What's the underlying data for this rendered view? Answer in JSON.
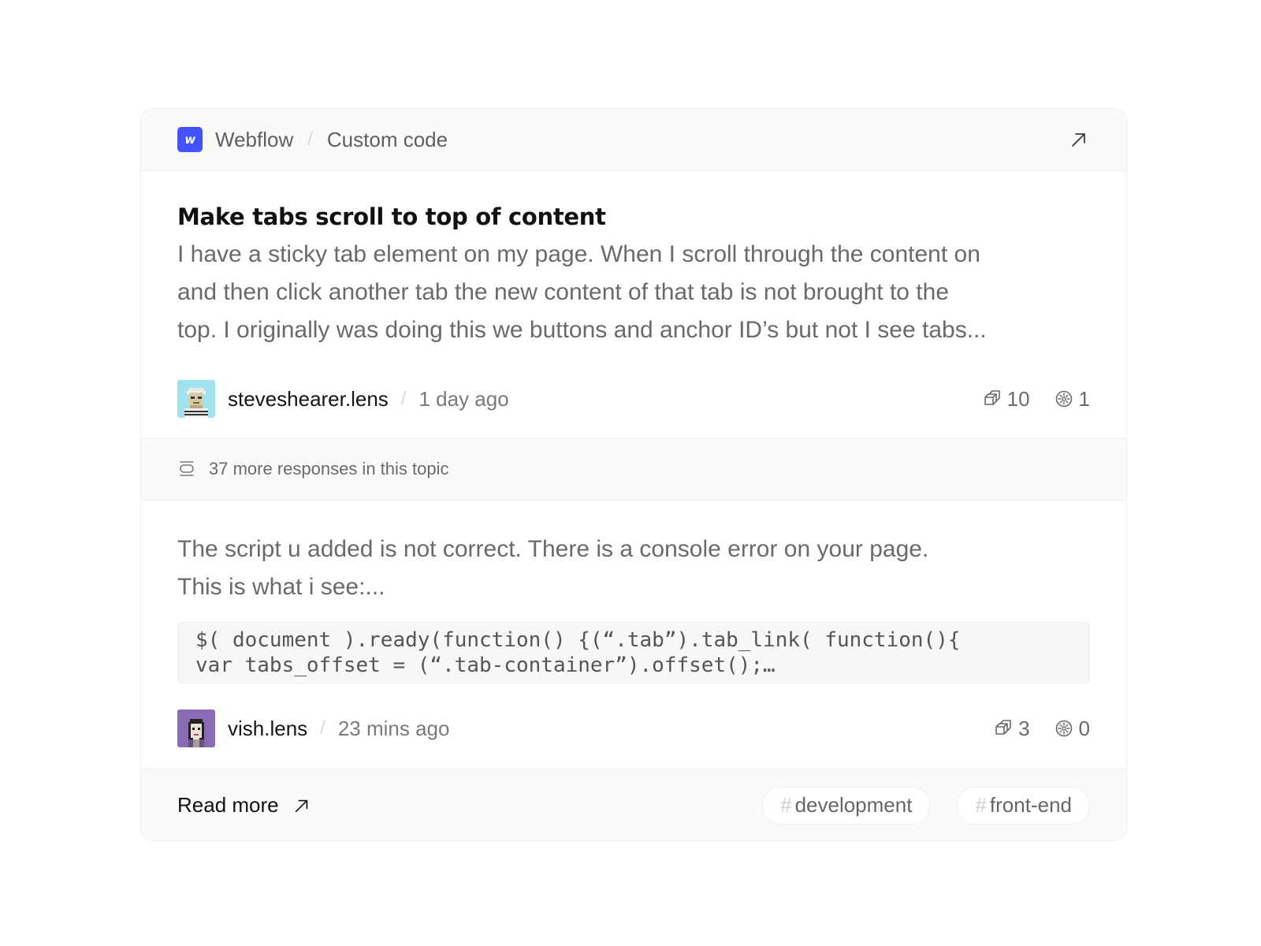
{
  "header": {
    "platform": "Webflow",
    "logo_letter": "w",
    "category": "Custom code",
    "separator": "/"
  },
  "post": {
    "title": "Make tabs scroll to top of content",
    "body_lines": [
      "I have a sticky tab element on my page. When I scroll through the content on",
      "and then click another tab the new content of that tab is not brought to the",
      "top. I originally was doing this we buttons and anchor ID’s but not I see tabs..."
    ],
    "author": "steveshearer.lens",
    "time": "1 day ago",
    "separator": "/",
    "collects": "10",
    "mirrors": "1"
  },
  "more_responses": {
    "text": "37 more responses in this topic"
  },
  "reply": {
    "body_lines": [
      "The script u added is not correct. There is a console error on your page.",
      "This is what i see:..."
    ],
    "code_lines": [
      "$( document ).ready(function() {(“.tab”).tab_link( function(){",
      "var tabs_offset = (“.tab-container”).offset();…"
    ],
    "author": "vish.lens",
    "time": "23 mins ago",
    "separator": "/",
    "collects": "3",
    "mirrors": "0"
  },
  "footer": {
    "read_more": "Read more",
    "tags": [
      {
        "hash": "#",
        "label": "development"
      },
      {
        "hash": "#",
        "label": "front-end"
      }
    ]
  },
  "colors": {
    "webflow_brand": "#4353ff",
    "card_border": "#efefef",
    "muted_bg": "#fafafa",
    "title_text": "#111111",
    "body_text": "#6a6a6a"
  },
  "icons": {
    "open": "arrow-up-right-icon",
    "collect": "collect-icon",
    "mirror": "mirror-icon",
    "responses": "responses-stack-icon",
    "read_more": "arrow-up-right-icon"
  }
}
